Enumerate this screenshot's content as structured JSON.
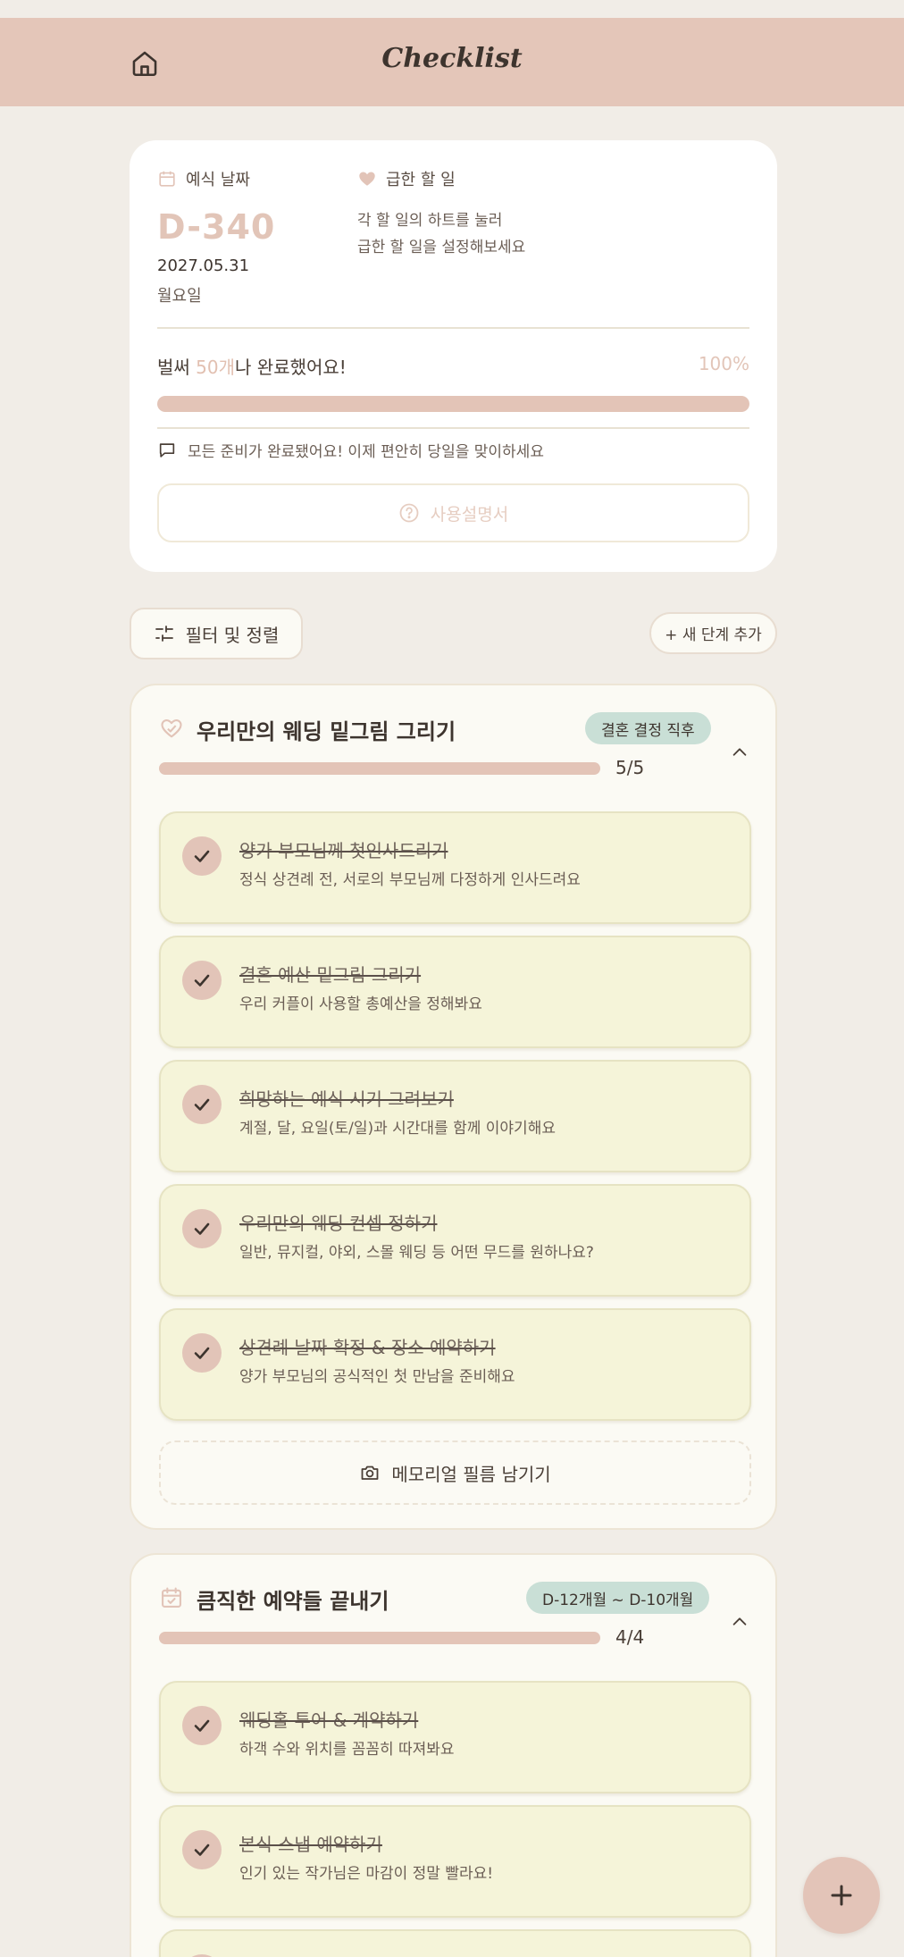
{
  "header": {
    "title": "Checklist",
    "home_icon": "home-icon"
  },
  "summary": {
    "wedding_date_label": "예식 날짜",
    "dday": "D-340",
    "date": "2027.05.31",
    "weekday": "월요일",
    "urgent_label": "급한 할 일",
    "urgent_desc_line1": "각 할 일의 하트를 눌러",
    "urgent_desc_line2": "급한 할 일을 설정해보세요",
    "progress_prefix": "벌써 ",
    "progress_count": "50개",
    "progress_suffix": "나 완료했어요!",
    "progress_percent": "100%",
    "progress_value": 1.0,
    "message": "모든 준비가 완료됐어요! 이제 편안히 당일을 맞이하세요",
    "guide_button": "사용설명서"
  },
  "toolbar": {
    "filter_label": "필터 및 정렬",
    "add_step_label": "+ 새 단계 추가"
  },
  "stages": [
    {
      "title": "우리만의 웨딩 밑그림 그리기",
      "badge": "결혼 결정 직후",
      "count": "5/5",
      "progress": 1.0,
      "tasks": [
        {
          "title": "양가 부모님께 첫인사드리기",
          "desc": "정식 상견례 전, 서로의 부모님께 다정하게 인사드려요"
        },
        {
          "title": "결혼 예산 밑그림 그리기",
          "desc": "우리 커플이 사용할 총예산을 정해봐요"
        },
        {
          "title": "희망하는 예식 시기 그려보기",
          "desc": "계절, 달, 요일(토/일)과 시간대를 함께 이야기해요"
        },
        {
          "title": "우리만의 웨딩 컨셉 정하기",
          "desc": "일반, 뮤지컬, 야외, 스몰 웨딩 등 어떤 무드를 원하나요?"
        },
        {
          "title": "상견례 날짜 확정 & 장소 예약하기",
          "desc": "양가 부모님의 공식적인 첫 만남을 준비해요"
        }
      ],
      "memorial_button": "메모리얼 필름 남기기"
    },
    {
      "title": "큼직한 예약들 끝내기",
      "badge": "D-12개월 ~ D-10개월",
      "count": "4/4",
      "progress": 1.0,
      "tasks": [
        {
          "title": "웨딩홀 투어 & 계약하기",
          "desc": "하객 수와 위치를 꼼꼼히 따져봐요"
        },
        {
          "title": "본식 스냅 예약하기",
          "desc": "인기 있는 작가님은 마감이 정말 빨라요!"
        }
      ]
    }
  ],
  "colors": {
    "header_bg": "#e4c6b9",
    "accent": "#e2c4b8",
    "task_bg": "#f5f4d9",
    "badge_bg": "#c9dfd6",
    "page_bg": "#f1ede7"
  }
}
